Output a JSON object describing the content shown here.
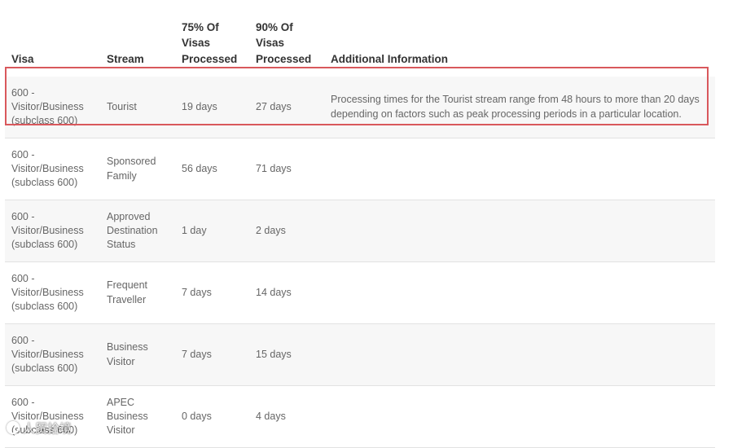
{
  "table": {
    "headers": {
      "visa": "Visa",
      "stream": "Stream",
      "p75": "75% Of\nVisas\nProcessed",
      "p90": "90% Of\nVisas\nProcessed",
      "info": "Additional Information"
    },
    "rows": [
      {
        "visa": "600 -\nVisitor/Business\n(subclass 600)",
        "stream": "Tourist",
        "p75": "19 days",
        "p90": "27 days",
        "info": "Processing times for the Tourist stream range from 48 hours to more than 20 days depending on factors such as peak processing periods in a particular location."
      },
      {
        "visa": "600 -\nVisitor/Business\n(subclass 600)",
        "stream": "Sponsored\nFamily",
        "p75": "56 days",
        "p90": "71 days",
        "info": ""
      },
      {
        "visa": "600 -\nVisitor/Business\n(subclass 600)",
        "stream": "Approved\nDestination\nStatus",
        "p75": "1 day",
        "p90": "2 days",
        "info": ""
      },
      {
        "visa": "600 -\nVisitor/Business\n(subclass 600)",
        "stream": "Frequent\nTraveller",
        "p75": "7 days",
        "p90": "14 days",
        "info": ""
      },
      {
        "visa": "600 -\nVisitor/Business\n(subclass 600)",
        "stream": "Business\nVisitor",
        "p75": "7 days",
        "p90": "15 days",
        "info": ""
      },
      {
        "visa": "600 -\nVisitor/Business\n(subclass 600)",
        "stream": "APEC\nBusiness\nVisitor",
        "p75": "0 days",
        "p90": "4 days",
        "info": ""
      }
    ],
    "highlight_color": "#d9585c"
  },
  "watermark": {
    "text": "人贸拾境",
    "icon": "logo-circle-icon"
  }
}
